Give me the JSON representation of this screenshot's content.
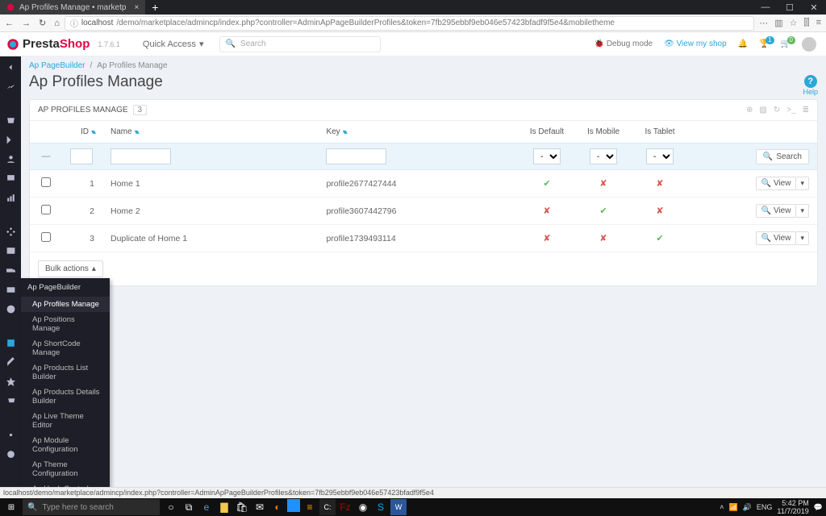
{
  "browser_tab": "Ap Profiles Manage • marketp",
  "url_host": "localhost",
  "url_path": "/demo/marketplace/admincp/index.php?controller=AdminApPageBuilderProfiles&token=7fb295ebbf9eb046e57423bfadf9f5e4&mobiletheme",
  "brand1": "Presta",
  "brand2": "Shop",
  "version": "1.7.6.1",
  "quick_access": "Quick Access",
  "search_placeholder": "Search",
  "debug": "Debug mode",
  "view_shop": "View my shop",
  "breadcrumbs": {
    "a": "Ap PageBuilder",
    "b": "Ap Profiles Manage"
  },
  "page_title": "Ap Profiles Manage",
  "help": "Help",
  "panel_title": "AP PROFILES MANAGE",
  "count": "3",
  "cols": {
    "id": "ID",
    "name": "Name",
    "key": "Key",
    "def": "Is Default",
    "mob": "Is Mobile",
    "tab": "Is Tablet"
  },
  "search_btn": "Search",
  "view": "View",
  "bulk": "Bulk actions",
  "rows": [
    {
      "id": "1",
      "name": "Home 1",
      "key": "profile2677427444",
      "def": true,
      "mob": false,
      "tab": false
    },
    {
      "id": "2",
      "name": "Home 2",
      "key": "profile3607442796",
      "def": false,
      "mob": true,
      "tab": false
    },
    {
      "id": "3",
      "name": "Duplicate of Home 1",
      "key": "profile1739493114",
      "def": false,
      "mob": false,
      "tab": true
    }
  ],
  "flyout": {
    "title": "Ap PageBuilder",
    "items": [
      "Ap Profiles Manage",
      "Ap Positions Manage",
      "Ap ShortCode Manage",
      "Ap Products List Builder",
      "Ap Products Details Builder",
      "Ap Live Theme Editor",
      "Ap Module Configuration",
      "Ap Theme Configuration",
      "Ap Hook Control Panel"
    ]
  },
  "status_url": "localhost/demo/marketplace/admincp/index.php?controller=AdminApPageBuilderProfiles&token=7fb295ebbf9eb046e57423bfadf9f5e4",
  "task_search": "Type here to search",
  "clock": {
    "t": "5:42 PM",
    "d": "11/7/2019"
  },
  "lang": "ENG"
}
